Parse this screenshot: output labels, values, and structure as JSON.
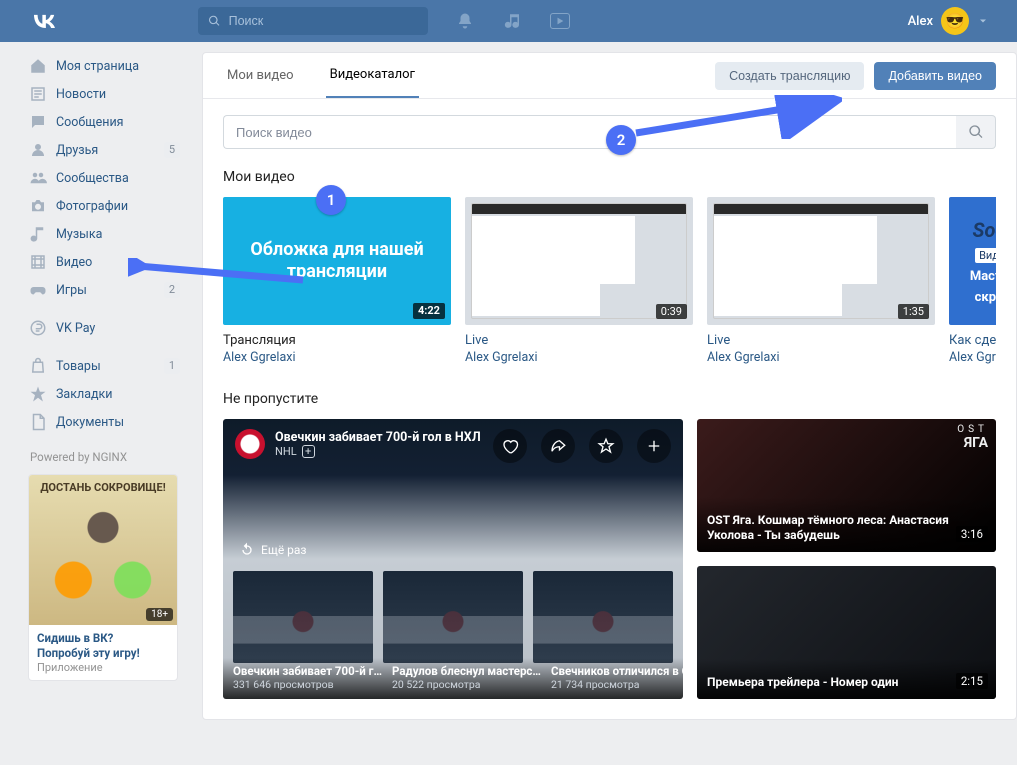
{
  "header": {
    "search_placeholder": "Поиск",
    "user_name": "Alex"
  },
  "sidebar": {
    "items": [
      {
        "label": "Моя страница"
      },
      {
        "label": "Новости"
      },
      {
        "label": "Сообщения"
      },
      {
        "label": "Друзья",
        "badge": "5"
      },
      {
        "label": "Сообщества"
      },
      {
        "label": "Фотографии"
      },
      {
        "label": "Музыка"
      },
      {
        "label": "Видео"
      },
      {
        "label": "Игры",
        "badge": "2"
      }
    ],
    "secondary": [
      {
        "label": "VK Pay"
      }
    ],
    "tertiary": [
      {
        "label": "Товары",
        "badge": "1"
      },
      {
        "label": "Закладки"
      },
      {
        "label": "Документы"
      }
    ],
    "footer": "Powered by NGINX",
    "ad": {
      "banner": "ДОСТАНЬ СОКРОВИЩЕ!",
      "age": "18+",
      "title": "Сидишь в ВК? Попробуй эту игру!",
      "sub": "Приложение"
    }
  },
  "content": {
    "tabs": {
      "my": "Мои видео",
      "catalog": "Видеокаталог"
    },
    "actions": {
      "stream": "Создать трансляцию",
      "add": "Добавить видео"
    },
    "search_placeholder": "Поиск видео",
    "section_my": "Мои видео",
    "videos": [
      {
        "overlay_text": "Обложка для нашей трансляции",
        "dur": "4:22",
        "title": "Трансляция",
        "author": "Alex Ggrelaxi",
        "title_link": false
      },
      {
        "dur": "0:39",
        "title": "Live",
        "author": "Alex Ggrelaxi",
        "title_link": true
      },
      {
        "dur": "1:35",
        "title": "Live",
        "author": "Alex Ggrelaxi",
        "title_link": true
      },
      {
        "cut_top": "Soc",
        "cut_btn": "Вид",
        "cut_mid1": "Масте",
        "cut_mid2": "скри",
        "title": "Как сдела",
        "author": "Alex Ggre"
      }
    ],
    "section_dontmiss": "Не пропустите",
    "dm": {
      "head_title": "Овечкин забивает 700-й гол в НХЛ",
      "head_sub": "NHL",
      "replay": "Ещё раз",
      "thumbs": [
        {
          "t": "Овечкин забивает 700-й г…",
          "v": "331 646 просмотров"
        },
        {
          "t": "Радулов блеснул мастерс…",
          "v": "20 522 просмотра"
        },
        {
          "t": "Свечников отличился в ОТ",
          "v": "21 734 просмотра"
        }
      ]
    },
    "dm_side": [
      {
        "title": "OST Яга. Кошмар тёмного леса: Анастасия Уколова - Ты забудешь",
        "dur": "3:16",
        "ost1": "OST",
        "ost2": "ЯГА"
      },
      {
        "title": "Премьера трейлера - Номер один",
        "dur": "2:15"
      }
    ]
  },
  "annotations": {
    "n1": "1",
    "n2": "2"
  }
}
